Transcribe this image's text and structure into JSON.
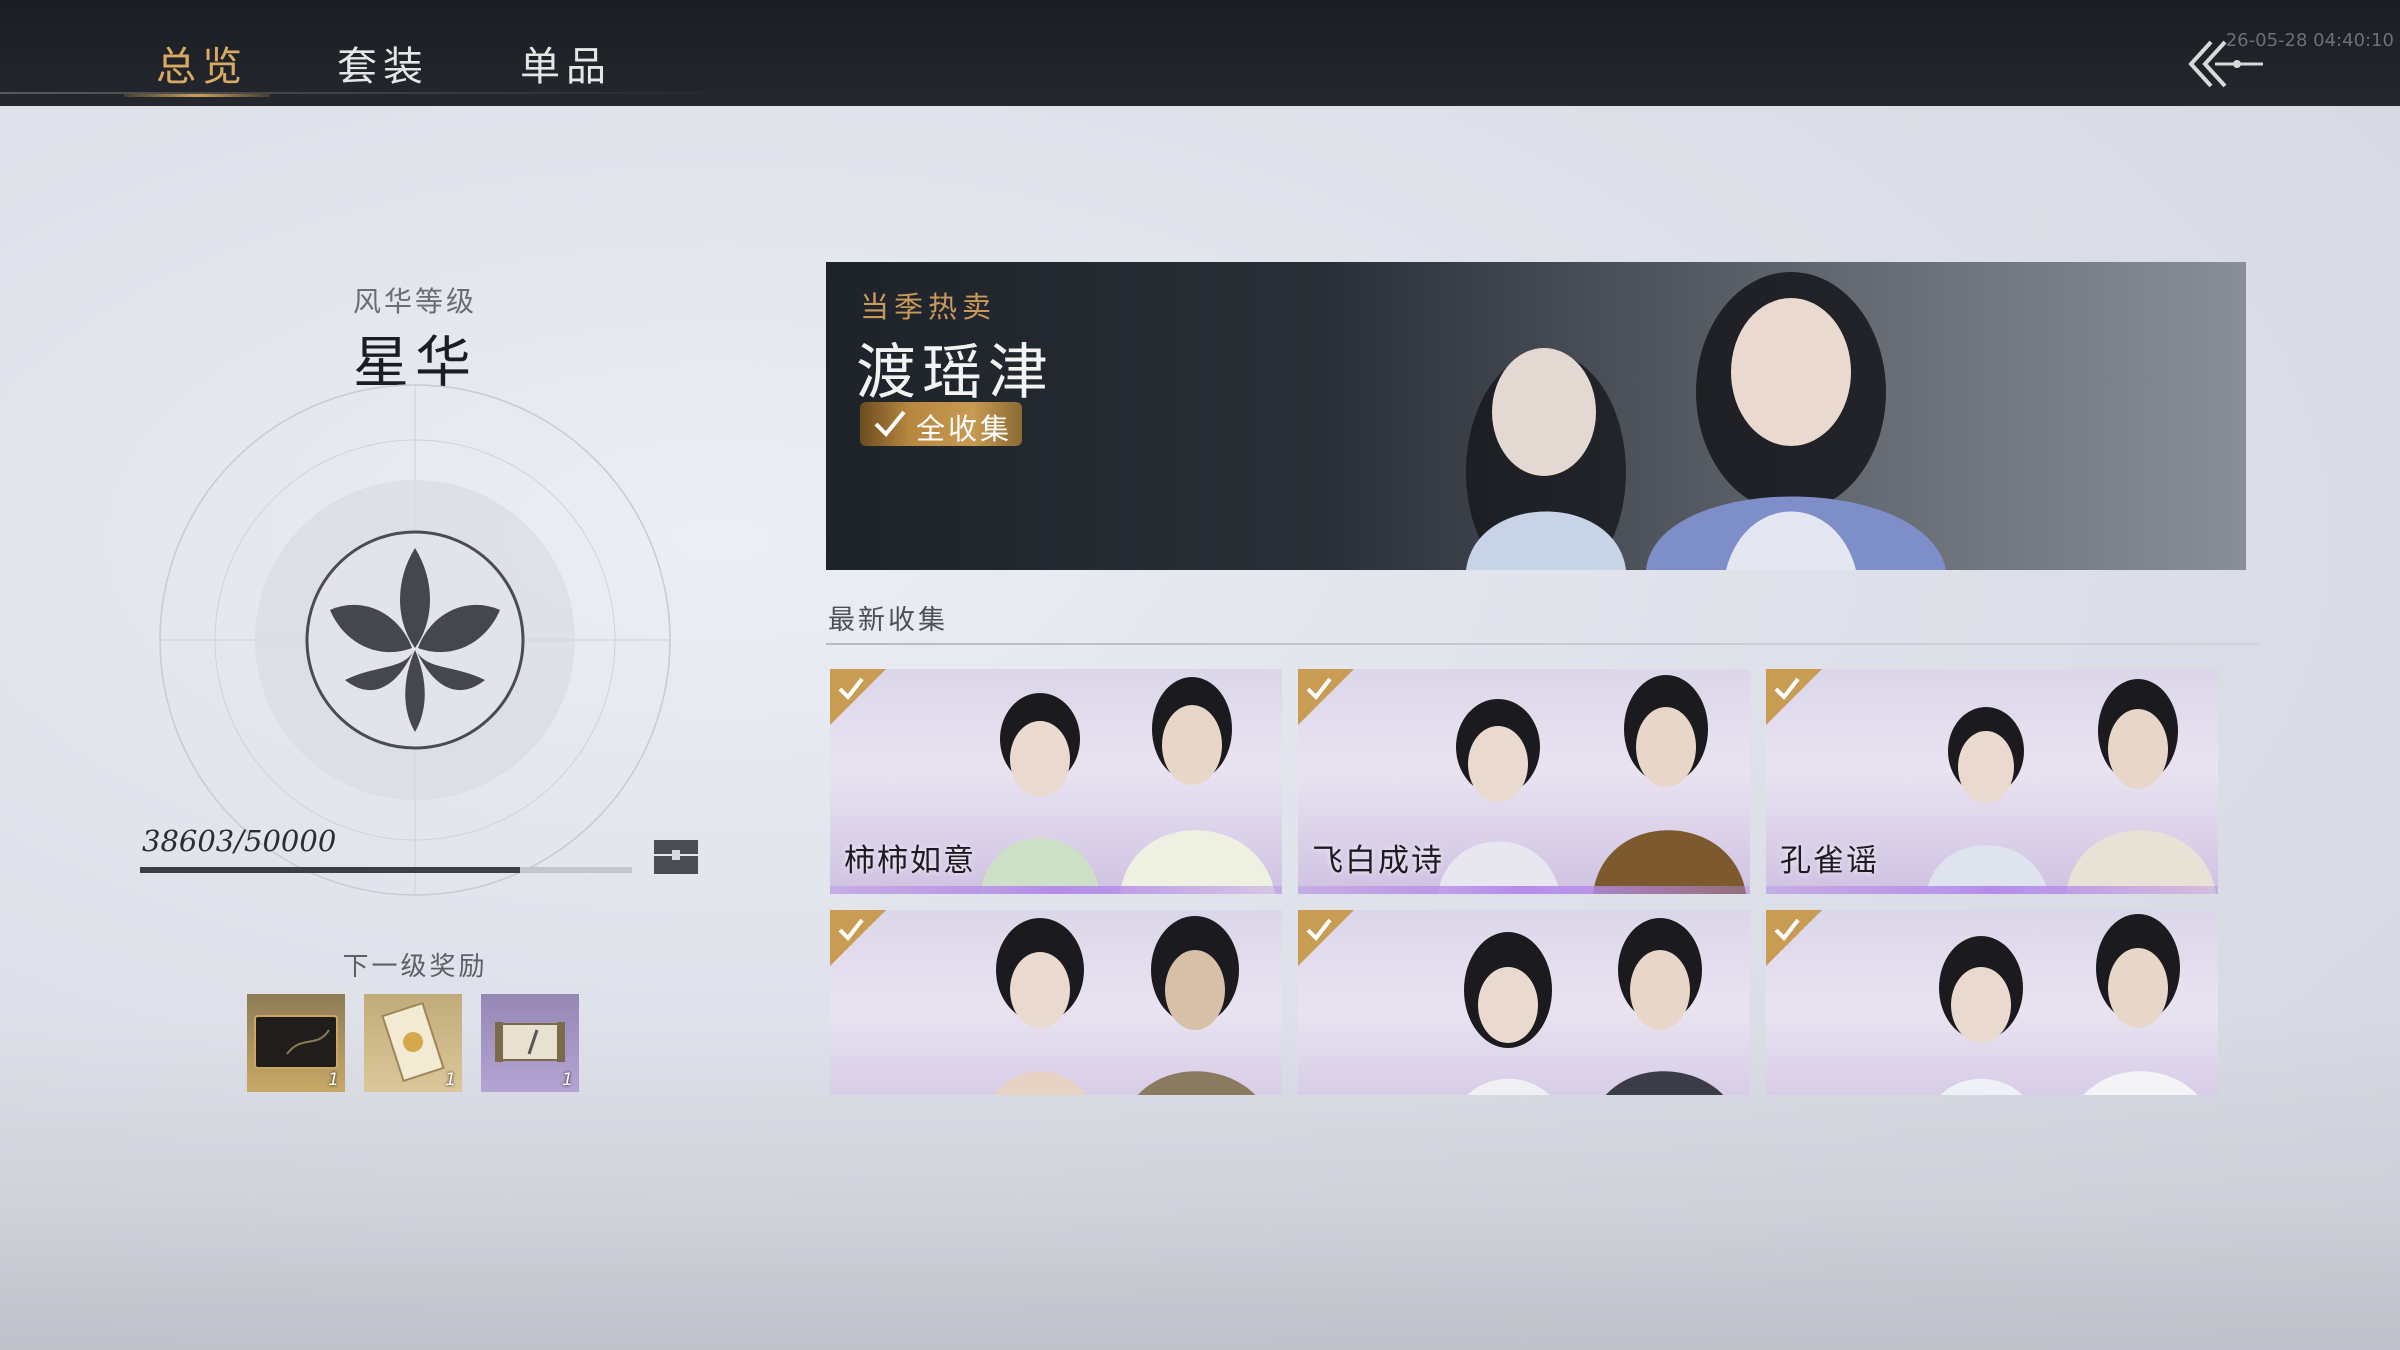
{
  "tabs": [
    {
      "label": "总览",
      "active": true
    },
    {
      "label": "套装",
      "active": false
    },
    {
      "label": "单品",
      "active": false
    }
  ],
  "timestamp": "26-05-28 04:40:10",
  "fenghua": {
    "label": "风华等级",
    "level": "星华",
    "progress_text": "38603/50000",
    "progress_value": 38603,
    "progress_max": 50000
  },
  "rewards": {
    "label": "下一级奖励",
    "items": [
      {
        "icon": "card-icon",
        "qty": "1"
      },
      {
        "icon": "scroll-icon",
        "qty": "1"
      },
      {
        "icon": "scroll-quill-icon",
        "qty": "1"
      }
    ]
  },
  "banner": {
    "tag": "当季热卖",
    "title": "渡瑶津",
    "badge": "全收集"
  },
  "latest": {
    "title": "最新收集",
    "items": [
      {
        "name": "柿柿如意",
        "collected": true
      },
      {
        "name": "飞白成诗",
        "collected": true
      },
      {
        "name": "孔雀谣",
        "collected": true
      },
      {
        "name": "",
        "collected": true
      },
      {
        "name": "",
        "collected": true
      },
      {
        "name": "",
        "collected": true
      }
    ]
  },
  "colors": {
    "accent_gold": "#d8aa63",
    "topbar": "#1e2126",
    "card_glow": "#b58bea"
  }
}
